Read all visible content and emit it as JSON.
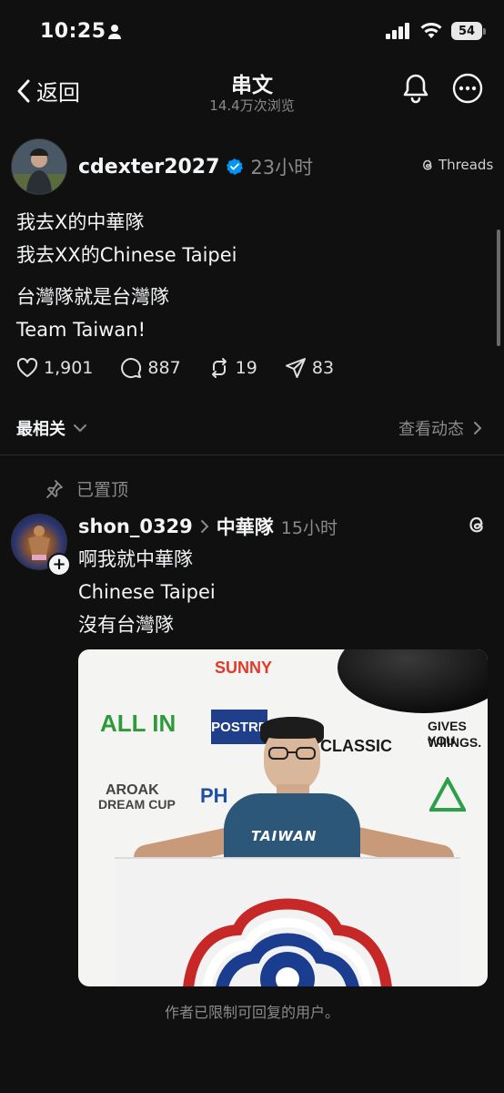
{
  "status_bar": {
    "time": "10:25",
    "battery": "54"
  },
  "nav": {
    "back_label": "返回",
    "title": "串文",
    "views": "14.4万次浏览"
  },
  "post": {
    "author": "cdexter2027",
    "time": "23小时",
    "app_tag": "Threads",
    "lines": [
      "我去X的中華隊",
      "我去XX的Chinese Taipei",
      "台灣隊就是台灣隊",
      "Team Taiwan!"
    ],
    "likes": "1,901",
    "comments": "887",
    "reposts": "19",
    "shares": "83"
  },
  "replies_bar": {
    "sort_label": "最相关",
    "activity_label": "查看动态"
  },
  "pinned_reply": {
    "pinned_label": "已置顶",
    "author": "shon_0329",
    "reply_to": "中華隊",
    "time": "15小时",
    "lines": [
      "啊我就中華隊",
      "Chinese Taipei",
      "沒有台灣隊"
    ],
    "photo_logos": {
      "sunny": "SUNNY",
      "all_in": "ALL IN",
      "postre": "POSTRE",
      "classic": "CLASSIC",
      "gives": "GIVES YOU",
      "wings": "WIIINGS.",
      "aroak": "AROAK",
      "dream_cup": "DREAM CUP",
      "ph": "PH",
      "shirt": "TAIWAN"
    }
  },
  "footer_note": "作者已限制可回复的用户。",
  "colors": {
    "background": "#101010",
    "text": "#f3f5f7",
    "muted": "#8a8a8a",
    "verified": "#0095f6"
  }
}
